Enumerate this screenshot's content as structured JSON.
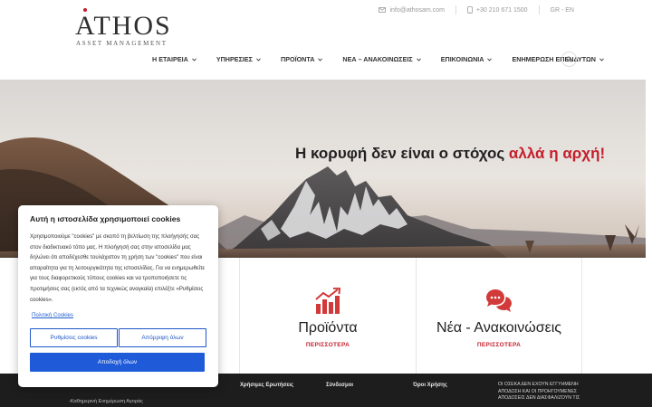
{
  "brand": {
    "name": "ATHOS",
    "tagline": "ASSET MANAGEMENT",
    "accent_color": "#c41f2c"
  },
  "topbar": {
    "email": "info@athosam.com",
    "phone": "+30 210 671 1500",
    "languages": "GR - EN",
    "email_icon": "envelope-icon",
    "phone_icon": "phone-icon"
  },
  "nav": {
    "items": [
      {
        "label": "Η ΕΤΑΙΡΕΙΑ"
      },
      {
        "label": "ΥΠΗΡΕΣΙΕΣ"
      },
      {
        "label": "ΠΡΟΪΟΝΤΑ"
      },
      {
        "label": "ΝΕΑ – ΑΝΑΚΟΙΝΩΣΕΙΣ"
      },
      {
        "label": "ΕΠΙΚΟΙΝΩΝΙΑ"
      },
      {
        "label": "ΕΝΗΜΕΡΩΣΗ ΕΠΕΝΔΥΤΩΝ"
      }
    ],
    "search_icon": "search-icon"
  },
  "hero": {
    "title_main": "Η κορυφή δεν είναι ο στόχος ",
    "title_accent": "αλλά η αρχή!"
  },
  "cards": [
    {
      "title": "Προϊόντα",
      "more": "ΠΕΡΙΣΣΟΤΕΡΑ",
      "icon": "bar-chart-growth-icon"
    },
    {
      "title": "Νέα - Ανακοινώσεις",
      "more": "ΠΕΡΙΣΣΟΤΕΡΑ",
      "icon": "chat-bubbles-icon"
    }
  ],
  "footer": {
    "col1_link": "-Καθημερινή Ενημέρωση Αγοράς",
    "col2_title": "Χρήσιμες Ερωτήσεις",
    "col3_title": "Σύνδεσμοι",
    "col4_title": "Όροι Χρήσης",
    "note_lines": [
      "ΟΙ ΟΣΕΚΑ ΔΕΝ ΕΧΟΥΝ ΕΓΓΥΗΜΕΝΗ",
      "ΑΠΟΔΟΣΗ ΚΑΙ ΟΙ ΠΡΟΗΓΟΥΜΕΝΕΣ",
      "ΑΠΟΔΟΣΕΙΣ ΔΕΝ ΔΙΑΣΦΑΛΙΖΟΥΝ ΤΙΣ"
    ]
  },
  "cookie": {
    "title": "Αυτή η ιστοσελίδα χρησιμοποιεί cookies",
    "text": "Χρησιμοποιούμε \"cookies\" με σκοπό τη βελτίωση της πλοήγησής σας στον διαδικτυακό τόπο μας. Η πλοήγησή σας στην ιστοσελίδα μας δηλώνει ότι αποδέχεσθε τουλάχιστον τη χρήση των \"cookies\" που είναι απαραίτητα για τη λειτουργικότητα της ιστοσελίδας. Για να ενημερωθείτε για τους διαφορετικούς τύπους cookies και να τροποποιήσετε τις προτιμήσεις σας (εκτός από τα τεχνικώς αναγκαία) επιλέξτε «Ρυθμίσεις cookies».",
    "policy_link": "Πολιτική Cookies",
    "settings_btn": "Ρυθμίσεις cookies",
    "reject_btn": "Απόρριψη όλων",
    "accept_btn": "Αποδοχή όλων",
    "button_color": "#1f5ad9"
  }
}
